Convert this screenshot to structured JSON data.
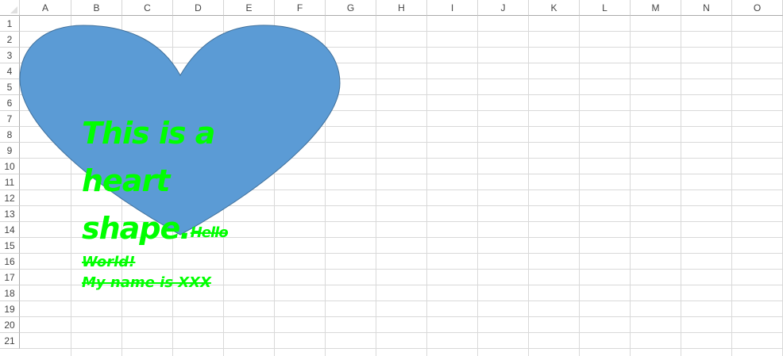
{
  "columns": [
    "A",
    "B",
    "C",
    "D",
    "E",
    "F",
    "G",
    "H",
    "I",
    "J",
    "K",
    "L",
    "M",
    "N",
    "O"
  ],
  "rows": [
    "1",
    "2",
    "3",
    "4",
    "5",
    "6",
    "7",
    "8",
    "9",
    "10",
    "11",
    "12",
    "13",
    "14",
    "15",
    "16",
    "17",
    "18",
    "19",
    "20",
    "21"
  ],
  "shape": {
    "type": "heart",
    "fill": "#5b9bd5",
    "outline": "#41719c",
    "text_color": "#00ff00",
    "text": {
      "line1": "This is a",
      "line2": "heart",
      "line3": "shape.",
      "strike1": "Hello",
      "strike2": "World!",
      "strike3": "My name is XXX"
    }
  },
  "colors": {
    "gridline": "#d9d9d9",
    "header_text": "#444444"
  }
}
